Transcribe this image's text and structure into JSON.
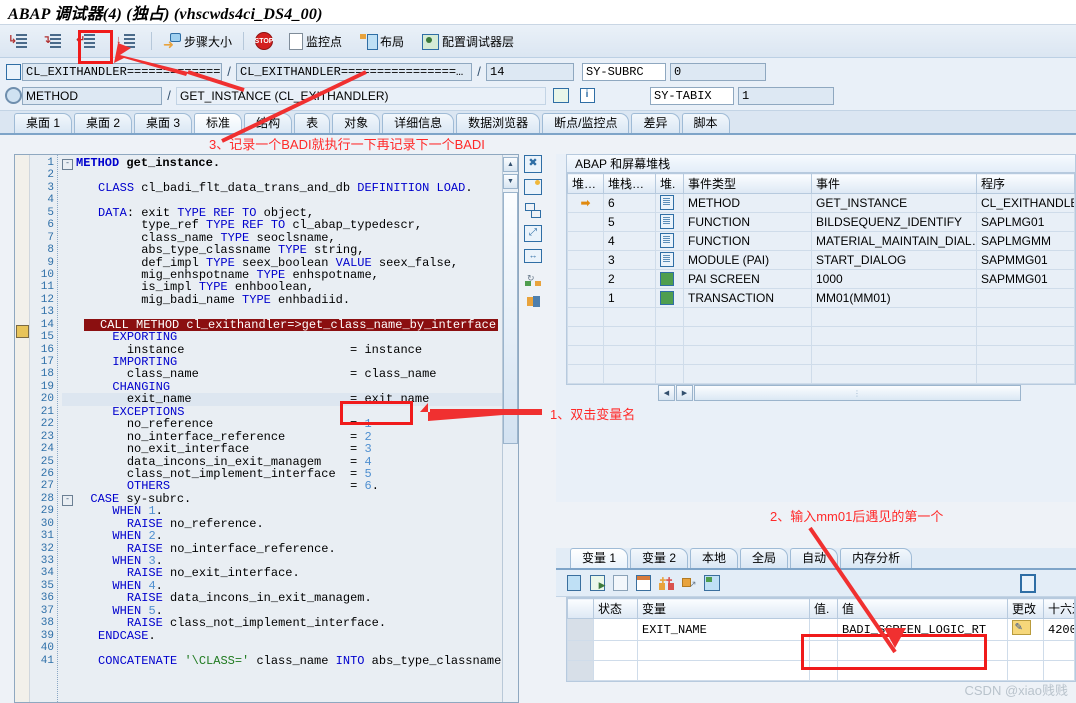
{
  "window": {
    "title": "ABAP 调试器(4) (独占) (vhscwds4ci_DS4_00)"
  },
  "toolbar": {
    "buttons": [
      {
        "name": "step-into",
        "label": ""
      },
      {
        "name": "step-over",
        "label": ""
      },
      {
        "name": "step-return",
        "label": ""
      },
      {
        "name": "continue",
        "label": ""
      }
    ],
    "step_size_label": "步骤大小",
    "stop_label": "",
    "watchpoint_label": "监控点",
    "layout_label": "布局",
    "configure_debugger_layer_label": "配置调试器层"
  },
  "object_header": {
    "row1": {
      "program": "CL_EXITHANDLER=============…",
      "include": "CL_EXITHANDLER================…",
      "line": "14",
      "sy_subrc_label": "SY-SUBRC",
      "sy_subrc_value": "0"
    },
    "row2": {
      "event_type": "METHOD",
      "event": "GET_INSTANCE (CL_EXITHANDLER)",
      "sy_tabix_label": "SY-TABIX",
      "sy_tabix_value": "1"
    }
  },
  "main_tabs": [
    {
      "label": "桌面 1",
      "active": false
    },
    {
      "label": "桌面 2",
      "active": false
    },
    {
      "label": "桌面 3",
      "active": false
    },
    {
      "label": "标准",
      "active": true
    },
    {
      "label": "结构",
      "active": false
    },
    {
      "label": "表",
      "active": false
    },
    {
      "label": "对象",
      "active": false
    },
    {
      "label": "详细信息",
      "active": false
    },
    {
      "label": "数据浏览器",
      "active": false
    },
    {
      "label": "断点/监控点",
      "active": false
    },
    {
      "label": "差异",
      "active": false
    },
    {
      "label": "脚本",
      "active": false
    }
  ],
  "code": {
    "first_line": 1,
    "lines": [
      {
        "n": 1,
        "tokens": [
          {
            "t": "kw",
            "v": "METHOD"
          },
          {
            "t": "p",
            "v": " get_instance."
          }
        ],
        "fold": "minus",
        "bold": true
      },
      {
        "n": 2,
        "tokens": []
      },
      {
        "n": 3,
        "tokens": [
          {
            "t": "p",
            "v": "  "
          },
          {
            "t": "kw",
            "v": "CLASS"
          },
          {
            "t": "p",
            "v": " cl_badi_flt_data_trans_and_db "
          },
          {
            "t": "kw",
            "v": "DEFINITION LOAD"
          },
          {
            "t": "p",
            "v": "."
          }
        ]
      },
      {
        "n": 4,
        "tokens": []
      },
      {
        "n": 5,
        "tokens": [
          {
            "t": "p",
            "v": "  "
          },
          {
            "t": "kw",
            "v": "DATA"
          },
          {
            "t": "p",
            "v": ": exit "
          },
          {
            "t": "kw",
            "v": "TYPE REF TO"
          },
          {
            "t": "p",
            "v": " object,"
          }
        ]
      },
      {
        "n": 6,
        "tokens": [
          {
            "t": "p",
            "v": "        type_ref "
          },
          {
            "t": "kw",
            "v": "TYPE REF TO"
          },
          {
            "t": "p",
            "v": " cl_abap_typedescr,"
          }
        ]
      },
      {
        "n": 7,
        "tokens": [
          {
            "t": "p",
            "v": "        class_name "
          },
          {
            "t": "kw",
            "v": "TYPE"
          },
          {
            "t": "p",
            "v": " seoclsname,"
          }
        ]
      },
      {
        "n": 8,
        "tokens": [
          {
            "t": "p",
            "v": "        abs_type_classname "
          },
          {
            "t": "kw",
            "v": "TYPE"
          },
          {
            "t": "p",
            "v": " string,"
          }
        ]
      },
      {
        "n": 9,
        "tokens": [
          {
            "t": "p",
            "v": "        def_impl "
          },
          {
            "t": "kw",
            "v": "TYPE"
          },
          {
            "t": "p",
            "v": " seex_boolean "
          },
          {
            "t": "kw",
            "v": "VALUE"
          },
          {
            "t": "p",
            "v": " seex_false,"
          }
        ]
      },
      {
        "n": 10,
        "tokens": [
          {
            "t": "p",
            "v": "        mig_enhspotname "
          },
          {
            "t": "kw",
            "v": "TYPE"
          },
          {
            "t": "p",
            "v": " enhspotname,"
          }
        ]
      },
      {
        "n": 11,
        "tokens": [
          {
            "t": "p",
            "v": "        is_impl "
          },
          {
            "t": "kw",
            "v": "TYPE"
          },
          {
            "t": "p",
            "v": " enhboolean,"
          }
        ]
      },
      {
        "n": 12,
        "tokens": [
          {
            "t": "p",
            "v": "        mig_badi_name "
          },
          {
            "t": "kw",
            "v": "TYPE"
          },
          {
            "t": "p",
            "v": " enhbadiid."
          }
        ]
      },
      {
        "n": 13,
        "tokens": []
      },
      {
        "n": 14,
        "highlight": true,
        "tokens": [
          {
            "t": "p",
            "v": "  CALL METHOD cl_exithandler=>get_class_name_by_interface"
          }
        ]
      },
      {
        "n": 15,
        "tokens": [
          {
            "t": "p",
            "v": "    "
          },
          {
            "t": "kw",
            "v": "EXPORTING"
          }
        ]
      },
      {
        "n": 16,
        "tokens": [
          {
            "t": "p",
            "v": "      instance                       = instance"
          }
        ]
      },
      {
        "n": 17,
        "tokens": [
          {
            "t": "p",
            "v": "    "
          },
          {
            "t": "kw",
            "v": "IMPORTING"
          }
        ]
      },
      {
        "n": 18,
        "tokens": [
          {
            "t": "p",
            "v": "      class_name                     = class_name"
          }
        ]
      },
      {
        "n": 19,
        "tokens": [
          {
            "t": "p",
            "v": "    "
          },
          {
            "t": "kw",
            "v": "CHANGING"
          }
        ]
      },
      {
        "n": 20,
        "current": true,
        "tokens": [
          {
            "t": "p",
            "v": "      exit_name                      = exit_name"
          }
        ]
      },
      {
        "n": 21,
        "tokens": [
          {
            "t": "p",
            "v": "    "
          },
          {
            "t": "kw",
            "v": "EXCEPTIONS"
          }
        ]
      },
      {
        "n": 22,
        "tokens": [
          {
            "t": "p",
            "v": "      no_reference                   = "
          },
          {
            "t": "num",
            "v": "1"
          }
        ]
      },
      {
        "n": 23,
        "tokens": [
          {
            "t": "p",
            "v": "      no_interface_reference         = "
          },
          {
            "t": "num",
            "v": "2"
          }
        ]
      },
      {
        "n": 24,
        "tokens": [
          {
            "t": "p",
            "v": "      no_exit_interface              = "
          },
          {
            "t": "num",
            "v": "3"
          }
        ]
      },
      {
        "n": 25,
        "tokens": [
          {
            "t": "p",
            "v": "      data_incons_in_exit_managem    = "
          },
          {
            "t": "num",
            "v": "4"
          }
        ]
      },
      {
        "n": 26,
        "tokens": [
          {
            "t": "p",
            "v": "      class_not_implement_interface  = "
          },
          {
            "t": "num",
            "v": "5"
          }
        ]
      },
      {
        "n": 27,
        "tokens": [
          {
            "t": "p",
            "v": "      "
          },
          {
            "t": "kw",
            "v": "OTHERS"
          },
          {
            "t": "p",
            "v": "                         = "
          },
          {
            "t": "num",
            "v": "6"
          },
          {
            "t": "p",
            "v": "."
          }
        ]
      },
      {
        "n": 28,
        "fold": "minus",
        "tokens": [
          {
            "t": "p",
            "v": "  "
          },
          {
            "t": "kw",
            "v": "CASE"
          },
          {
            "t": "p",
            "v": " sy-subrc."
          }
        ]
      },
      {
        "n": 29,
        "tokens": [
          {
            "t": "p",
            "v": "    "
          },
          {
            "t": "kw",
            "v": "WHEN"
          },
          {
            "t": "p",
            "v": " "
          },
          {
            "t": "num",
            "v": "1"
          },
          {
            "t": "p",
            "v": "."
          }
        ]
      },
      {
        "n": 30,
        "tokens": [
          {
            "t": "p",
            "v": "      "
          },
          {
            "t": "kw",
            "v": "RAISE"
          },
          {
            "t": "p",
            "v": " no_reference."
          }
        ]
      },
      {
        "n": 31,
        "tokens": [
          {
            "t": "p",
            "v": "    "
          },
          {
            "t": "kw",
            "v": "WHEN"
          },
          {
            "t": "p",
            "v": " "
          },
          {
            "t": "num",
            "v": "2"
          },
          {
            "t": "p",
            "v": "."
          }
        ]
      },
      {
        "n": 32,
        "tokens": [
          {
            "t": "p",
            "v": "      "
          },
          {
            "t": "kw",
            "v": "RAISE"
          },
          {
            "t": "p",
            "v": " no_interface_reference."
          }
        ]
      },
      {
        "n": 33,
        "tokens": [
          {
            "t": "p",
            "v": "    "
          },
          {
            "t": "kw",
            "v": "WHEN"
          },
          {
            "t": "p",
            "v": " "
          },
          {
            "t": "num",
            "v": "3"
          },
          {
            "t": "p",
            "v": "."
          }
        ]
      },
      {
        "n": 34,
        "tokens": [
          {
            "t": "p",
            "v": "      "
          },
          {
            "t": "kw",
            "v": "RAISE"
          },
          {
            "t": "p",
            "v": " no_exit_interface."
          }
        ]
      },
      {
        "n": 35,
        "tokens": [
          {
            "t": "p",
            "v": "    "
          },
          {
            "t": "kw",
            "v": "WHEN"
          },
          {
            "t": "p",
            "v": " "
          },
          {
            "t": "num",
            "v": "4"
          },
          {
            "t": "p",
            "v": "."
          }
        ]
      },
      {
        "n": 36,
        "tokens": [
          {
            "t": "p",
            "v": "      "
          },
          {
            "t": "kw",
            "v": "RAISE"
          },
          {
            "t": "p",
            "v": " data_incons_in_exit_managem."
          }
        ]
      },
      {
        "n": 37,
        "tokens": [
          {
            "t": "p",
            "v": "    "
          },
          {
            "t": "kw",
            "v": "WHEN"
          },
          {
            "t": "p",
            "v": " "
          },
          {
            "t": "num",
            "v": "5"
          },
          {
            "t": "p",
            "v": "."
          }
        ]
      },
      {
        "n": 38,
        "tokens": [
          {
            "t": "p",
            "v": "      "
          },
          {
            "t": "kw",
            "v": "RAISE"
          },
          {
            "t": "p",
            "v": " class_not_implement_interface."
          }
        ]
      },
      {
        "n": 39,
        "tokens": [
          {
            "t": "p",
            "v": "  "
          },
          {
            "t": "kw",
            "v": "ENDCASE"
          },
          {
            "t": "p",
            "v": "."
          }
        ]
      },
      {
        "n": 40,
        "tokens": []
      },
      {
        "n": 41,
        "tokens": [
          {
            "t": "p",
            "v": "  "
          },
          {
            "t": "kw",
            "v": "CONCATENATE"
          },
          {
            "t": "p",
            "v": " "
          },
          {
            "t": "str",
            "v": "'\\CLASS='"
          },
          {
            "t": "p",
            "v": " class_name "
          },
          {
            "t": "kw",
            "v": "INTO"
          },
          {
            "t": "p",
            "v": " abs_type_classname."
          }
        ]
      }
    ]
  },
  "stack": {
    "caption": "ABAP 和屏幕堆栈",
    "columns": [
      "堆…",
      "堆栈…",
      "堆.",
      "事件类型",
      "事件",
      "程序"
    ],
    "rows": [
      {
        "marker": "➡",
        "level": "6",
        "icon": "doc",
        "event_type": "METHOD",
        "event": "GET_INSTANCE",
        "program": "CL_EXITHANDLER==="
      },
      {
        "marker": "",
        "level": "5",
        "icon": "doc",
        "event_type": "FUNCTION",
        "event": "BILDSEQUENZ_IDENTIFY",
        "program": "SAPLMG01"
      },
      {
        "marker": "",
        "level": "4",
        "icon": "doc",
        "event_type": "FUNCTION",
        "event": "MATERIAL_MAINTAIN_DIAL…",
        "program": "SAPLMGMM"
      },
      {
        "marker": "",
        "level": "3",
        "icon": "doc",
        "event_type": "MODULE (PAI)",
        "event": "START_DIALOG",
        "program": "SAPMMG01"
      },
      {
        "marker": "",
        "level": "2",
        "icon": "scr",
        "event_type": "PAI SCREEN",
        "event": "1000",
        "program": "SAPMMG01"
      },
      {
        "marker": "",
        "level": "1",
        "icon": "scr",
        "event_type": "TRANSACTION",
        "event": "MM01(MM01)",
        "program": ""
      },
      {
        "marker": "",
        "level": "",
        "icon": "",
        "event_type": "",
        "event": "",
        "program": ""
      },
      {
        "marker": "",
        "level": "",
        "icon": "",
        "event_type": "",
        "event": "",
        "program": ""
      },
      {
        "marker": "",
        "level": "",
        "icon": "",
        "event_type": "",
        "event": "",
        "program": ""
      },
      {
        "marker": "",
        "level": "",
        "icon": "",
        "event_type": "",
        "event": "",
        "program": ""
      }
    ]
  },
  "variables": {
    "tabs": [
      {
        "label": "变量 1",
        "active": true
      },
      {
        "label": "变量 2",
        "active": false
      },
      {
        "label": "本地",
        "active": false
      },
      {
        "label": "全局",
        "active": false
      },
      {
        "label": "自动",
        "active": false
      },
      {
        "label": "内存分析",
        "active": false
      }
    ],
    "toolbar_icons": [
      "delete-icon",
      "insert-row-icon",
      "insert-row-after-icon",
      "remove-row-icon",
      "compare-icon",
      "transfer-icon",
      "restore-icon",
      "save-icon"
    ],
    "columns": [
      "",
      "状态",
      "变量",
      "值.",
      "值",
      "更改",
      "十六进…"
    ],
    "rows": [
      {
        "status": "",
        "variable": "EXIT_NAME",
        "val_short": "",
        "value": "BADI_SCREEN_LOGIC_RT",
        "change": "pencil",
        "hex": "4200"
      },
      {
        "status": "",
        "variable": "",
        "val_short": "",
        "value": "",
        "change": "",
        "hex": ""
      },
      {
        "status": "",
        "variable": "",
        "val_short": "",
        "value": "",
        "change": "",
        "hex": ""
      }
    ]
  },
  "annotations": {
    "note1": "1、双击变量名",
    "note2": "2、输入mm01后遇见的第一个",
    "note3": "3、记录一个BADI就执行一下再记录下一个BADI"
  },
  "watermark": "CSDN @xiao贱贱",
  "colors": {
    "accent": "#f01b1b",
    "highlight_bg": "#8b0f10",
    "keyword": "#0000cd",
    "string": "#1f7a1f",
    "number": "#4f8fd0"
  }
}
